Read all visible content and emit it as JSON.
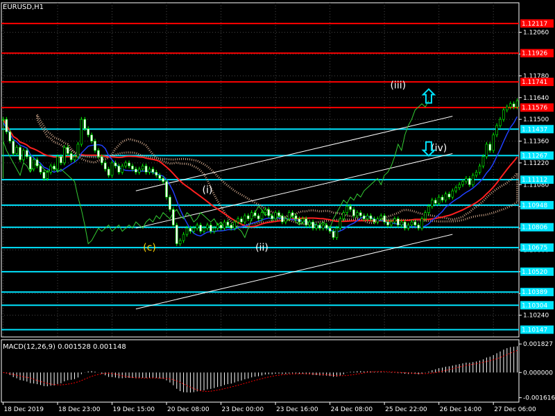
{
  "chart_data": {
    "type": "line",
    "symbol_label": "EURUSD,H1",
    "main_ylim": [
      1.101,
      1.1225
    ],
    "price_ticks": [
      "1.12060",
      "1.11920",
      "1.11780",
      "1.11640",
      "1.11500",
      "1.11360",
      "1.11220",
      "1.11080",
      "1.10940",
      "1.10800",
      "1.10660",
      "1.10520",
      "1.10380",
      "1.10240"
    ],
    "price_tick_values": [
      1.1206,
      1.1192,
      1.1178,
      1.1164,
      1.115,
      1.1136,
      1.1122,
      1.1108,
      1.1094,
      1.108,
      1.1066,
      1.1052,
      1.1038,
      1.1024
    ],
    "resistance_levels": [
      {
        "label": "1.12117",
        "value": 1.12117
      },
      {
        "label": "1.11926",
        "value": 1.11926
      },
      {
        "label": "1.11741",
        "value": 1.11741
      },
      {
        "label": "1.11576",
        "value": 1.11576
      }
    ],
    "support_levels": [
      {
        "label": "1.11437",
        "value": 1.11437
      },
      {
        "label": "1.11267",
        "value": 1.11267
      },
      {
        "label": "1.11112",
        "value": 1.11112
      },
      {
        "label": "1.10948",
        "value": 1.10948
      },
      {
        "label": "1.10806",
        "value": 1.10806
      },
      {
        "label": "1.10675",
        "value": 1.10675
      },
      {
        "label": "1.10520",
        "value": 1.1052
      },
      {
        "label": "1.10389",
        "value": 1.10389
      },
      {
        "label": "1.10304",
        "value": 1.10304
      },
      {
        "label": "1.10147",
        "value": 1.10147
      }
    ],
    "x_ticks": [
      "18 Dec 2019",
      "18 Dec 23:00",
      "19 Dec 15:00",
      "20 Dec 08:00",
      "23 Dec 00:00",
      "23 Dec 16:00",
      "24 Dec 08:00",
      "25 Dec 22:00",
      "26 Dec 14:00",
      "27 Dec 06:00"
    ],
    "x_tick_index": [
      0,
      16,
      32,
      48,
      64,
      80,
      96,
      112,
      128,
      144
    ],
    "bar_count": 152,
    "close": [
      1.115,
      1.1142,
      1.1136,
      1.1128,
      1.1132,
      1.1124,
      1.113,
      1.1126,
      1.1118,
      1.1124,
      1.112,
      1.1116,
      1.1112,
      1.1116,
      1.112,
      1.1118,
      1.1126,
      1.1122,
      1.1132,
      1.1128,
      1.1124,
      1.1126,
      1.1134,
      1.115,
      1.1144,
      1.114,
      1.1136,
      1.113,
      1.1126,
      1.1122,
      1.1118,
      1.1114,
      1.1122,
      1.112,
      1.1116,
      1.112,
      1.1122,
      1.112,
      1.1118,
      1.1116,
      1.1118,
      1.112,
      1.1116,
      1.1118,
      1.1116,
      1.1114,
      1.1112,
      1.111,
      1.11,
      1.1092,
      1.1082,
      1.107,
      1.1072,
      1.1076,
      1.108,
      1.1078,
      1.108,
      1.1082,
      1.1078,
      1.108,
      1.1082,
      1.1078,
      1.108,
      1.1082,
      1.108,
      1.1084,
      1.1082,
      1.108,
      1.1084,
      1.1086,
      1.1084,
      1.1088,
      1.1086,
      1.109,
      1.1088,
      1.1086,
      1.109,
      1.1092,
      1.1088,
      1.1086,
      1.109,
      1.1088,
      1.1084,
      1.1086,
      1.109,
      1.1088,
      1.1086,
      1.1084,
      1.1086,
      1.1082,
      1.1084,
      1.108,
      1.1082,
      1.108,
      1.1082,
      1.108,
      1.1078,
      1.1074,
      1.108,
      1.1086,
      1.109,
      1.1094,
      1.1092,
      1.1088,
      1.109,
      1.1088,
      1.1086,
      1.1088,
      1.1086,
      1.1084,
      1.1086,
      1.1088,
      1.1084,
      1.1082,
      1.1084,
      1.1086,
      1.1082,
      1.1084,
      1.108,
      1.1082,
      1.1084,
      1.1082,
      1.108,
      1.1086,
      1.109,
      1.1094,
      1.1098,
      1.1096,
      1.11,
      1.1098,
      1.1102,
      1.11,
      1.1104,
      1.1106,
      1.1108,
      1.111,
      1.1112,
      1.1108,
      1.1114,
      1.1116,
      1.112,
      1.1126,
      1.1134,
      1.113,
      1.114,
      1.1146,
      1.115,
      1.1156,
      1.1158,
      1.116,
      1.1158,
      1.1162
    ],
    "wave_labels": [
      {
        "text": "(c)",
        "index": 43,
        "value": 1.10655,
        "color": "#ffd700"
      },
      {
        "text": "(i)",
        "index": 60,
        "value": 1.11025,
        "color": "#ffffff"
      },
      {
        "text": "(ii)",
        "index": 76,
        "value": 1.10655,
        "color": "#ffffff"
      },
      {
        "text": "(iii)",
        "index": 116,
        "value": 1.117,
        "color": "#ffffff"
      },
      {
        "text": "(iv)",
        "index": 128,
        "value": 1.11295,
        "color": "#ffffff"
      }
    ],
    "arrows": [
      {
        "direction": "up",
        "index": 125,
        "value": 1.1165
      },
      {
        "direction": "down",
        "index": 125,
        "value": 1.1131
      }
    ],
    "macd": {
      "label": "MACD(12,26,9) 0.001528 0.001148",
      "ticks": [
        "0.001827",
        "0.000000",
        "-0.001616"
      ],
      "tick_values": [
        0.001827,
        0.0,
        -0.001616
      ],
      "ylim": [
        -0.0019,
        0.0021
      ]
    }
  }
}
